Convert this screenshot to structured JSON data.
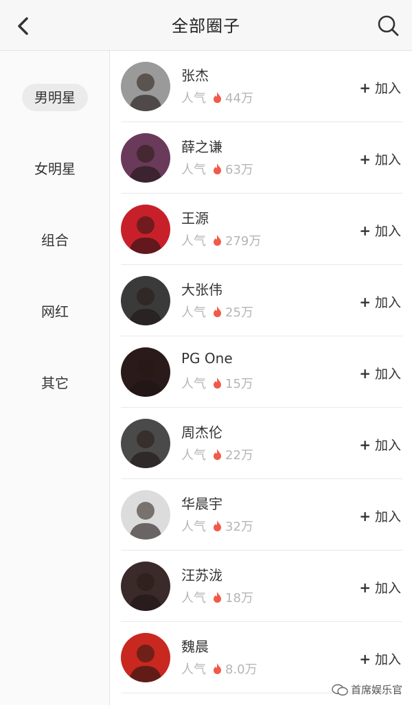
{
  "header": {
    "title": "全部圈子",
    "back_icon": "chevron-left-icon",
    "search_icon": "search-icon"
  },
  "sidebar": {
    "items": [
      {
        "label": "男明星",
        "active": true
      },
      {
        "label": "女明星",
        "active": false
      },
      {
        "label": "组合",
        "active": false
      },
      {
        "label": "网红",
        "active": false
      },
      {
        "label": "其它",
        "active": false
      }
    ]
  },
  "list": {
    "popularity_label": "人气",
    "join_label": "加入",
    "plus_symbol": "+",
    "flame_color": "#f05a4a",
    "items": [
      {
        "name": "张杰",
        "popularity": "44万",
        "avatar_bg": "#9a9a9a"
      },
      {
        "name": "薛之谦",
        "popularity": "63万",
        "avatar_bg": "#6a3a5a"
      },
      {
        "name": "王源",
        "popularity": "279万",
        "avatar_bg": "#c8202a"
      },
      {
        "name": "大张伟",
        "popularity": "25万",
        "avatar_bg": "#3a3a3a"
      },
      {
        "name": "PG One",
        "popularity": "15万",
        "avatar_bg": "#2a1a1a"
      },
      {
        "name": "周杰伦",
        "popularity": "22万",
        "avatar_bg": "#4a4a4a"
      },
      {
        "name": "华晨宇",
        "popularity": "32万",
        "avatar_bg": "#dcdcdc"
      },
      {
        "name": "汪苏泷",
        "popularity": "18万",
        "avatar_bg": "#3a2a2a"
      },
      {
        "name": "魏晨",
        "popularity": "8.0万",
        "avatar_bg": "#c82820"
      }
    ]
  },
  "watermark": {
    "text": "首席娱乐官"
  }
}
